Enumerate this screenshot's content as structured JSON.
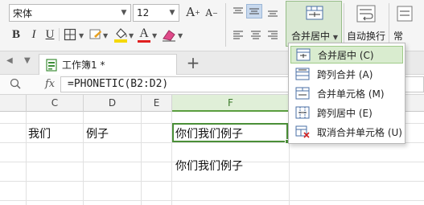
{
  "ribbon": {
    "font_name": "宋体",
    "font_size": "12",
    "grow_font": "A",
    "shrink_font": "A",
    "bold": "B",
    "italic": "I",
    "underline": "U",
    "font_color_glyph": "A",
    "merge_label": "合并居中",
    "wrap_label": "自动换行",
    "more_label": "常"
  },
  "tabs": {
    "active_tab": "工作簿1 *"
  },
  "formula": {
    "text": "=PHONETIC(B2:D2)"
  },
  "columns": [
    "C",
    "D",
    "E",
    "F"
  ],
  "cells": {
    "c2": "我们",
    "d2": "例子",
    "f2": "你们我们例子",
    "f4": "你们我们例子"
  },
  "merge_menu": {
    "items": [
      {
        "label": "合并居中 (C)",
        "icon": "merge-center-icon"
      },
      {
        "label": "跨列合并 (A)",
        "icon": "merge-across-icon"
      },
      {
        "label": "合并单元格 (M)",
        "icon": "merge-cells-icon"
      },
      {
        "label": "跨列居中 (E)",
        "icon": "center-across-icon"
      },
      {
        "label": "取消合并单元格 (U)",
        "icon": "unmerge-cells-icon"
      }
    ]
  },
  "colors": {
    "accent_green": "#4b8f38",
    "menu_hover": "#d9eccf",
    "font_color_red": "#e02020",
    "fill_yellow": "#f5d800"
  }
}
